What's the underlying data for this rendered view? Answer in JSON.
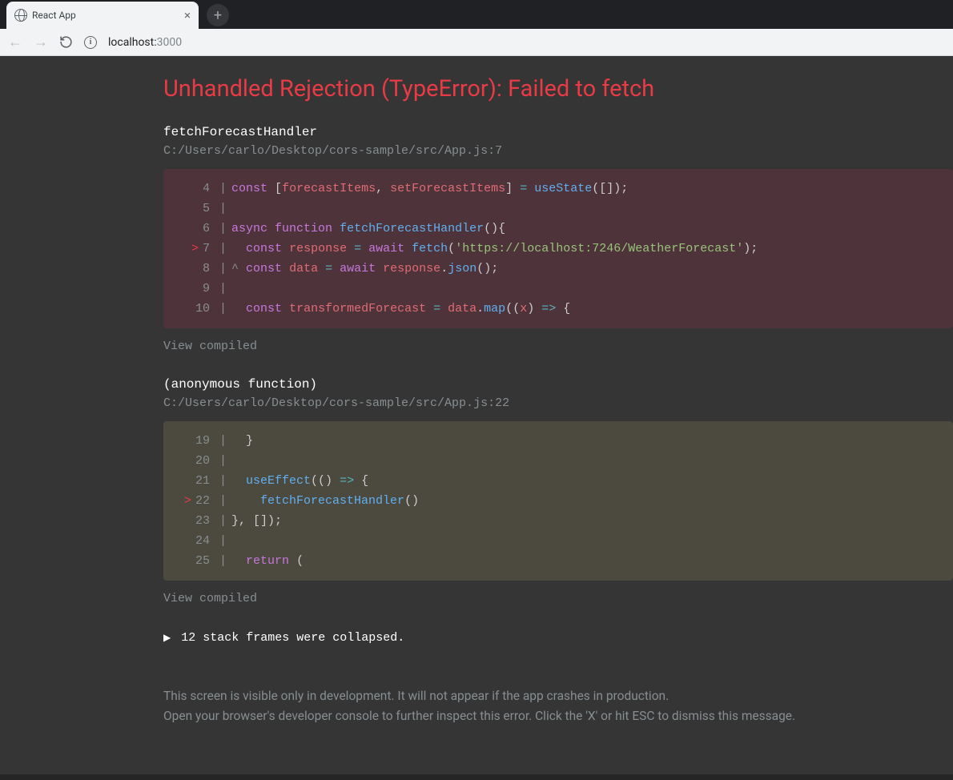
{
  "browser": {
    "tab_title": "React App",
    "url_host": "localhost:",
    "url_port": "3000"
  },
  "error": {
    "title": "Unhandled Rejection (TypeError): Failed to fetch",
    "frames": [
      {
        "func": "fetchForecastHandler",
        "path": "C:/Users/carlo/Desktop/cors-sample/src/App.js:7",
        "view_compiled": "View compiled",
        "block_class": "cb-a",
        "lines": [
          {
            "num": "4",
            "ptr": false,
            "html": "<span class='tok-kw'>const</span> <span class='tok-punc'>[</span><span class='tok-var'>forecastItems</span><span class='tok-punc'>,</span> <span class='tok-var'>setForecastItems</span><span class='tok-punc'>]</span> <span class='tok-op'>=</span> <span class='tok-fn'>useState</span><span class='tok-punc'>([]);</span>"
          },
          {
            "num": "5",
            "ptr": false,
            "html": ""
          },
          {
            "num": "6",
            "ptr": false,
            "html": "<span class='tok-kw'>async</span> <span class='tok-kw'>function</span> <span class='tok-fn'>fetchForecastHandler</span><span class='tok-punc'>(){</span>"
          },
          {
            "num": "7",
            "ptr": true,
            "html": "  <span class='tok-kw'>const</span> <span class='tok-var'>response</span> <span class='tok-op'>=</span> <span class='tok-kw'>await</span> <span class='tok-fn'>fetch</span><span class='tok-punc'>(</span><span class='tok-str'>'https://localhost:7246/WeatherForecast'</span><span class='tok-punc'>);</span>"
          },
          {
            "num": "8",
            "ptr": false,
            "html": "<span class='tok-caret'>^</span> <span class='tok-kw'>const</span> <span class='tok-var'>data</span> <span class='tok-op'>=</span> <span class='tok-kw'>await</span> <span class='tok-var'>response</span><span class='tok-punc'>.</span><span class='tok-fn'>json</span><span class='tok-punc'>();</span>"
          },
          {
            "num": "9",
            "ptr": false,
            "html": ""
          },
          {
            "num": "10",
            "ptr": false,
            "html": "  <span class='tok-kw'>const</span> <span class='tok-var'>transformedForecast</span> <span class='tok-op'>=</span> <span class='tok-var'>data</span><span class='tok-punc'>.</span><span class='tok-fn'>map</span><span class='tok-punc'>((</span><span class='tok-var'>x</span><span class='tok-punc'>)</span> <span class='tok-op'>=&gt;</span> <span class='tok-punc'>{</span>"
          }
        ]
      },
      {
        "func": "(anonymous function)",
        "path": "C:/Users/carlo/Desktop/cors-sample/src/App.js:22",
        "view_compiled": "View compiled",
        "block_class": "cb-b",
        "lines": [
          {
            "num": "19",
            "ptr": false,
            "html": "  <span class='tok-punc'>}</span>"
          },
          {
            "num": "20",
            "ptr": false,
            "html": ""
          },
          {
            "num": "21",
            "ptr": false,
            "html": "  <span class='tok-fn'>useEffect</span><span class='tok-punc'>(()</span> <span class='tok-op'>=&gt;</span> <span class='tok-punc'>{</span>"
          },
          {
            "num": "22",
            "ptr": true,
            "html": "    <span class='tok-fn'>fetchForecastHandler</span><span class='tok-punc'>()</span>"
          },
          {
            "num": "23",
            "ptr": false,
            "html": "<span class='tok-punc'>},</span> <span class='tok-punc'>[]);</span>"
          },
          {
            "num": "24",
            "ptr": false,
            "html": ""
          },
          {
            "num": "25",
            "ptr": false,
            "html": "  <span class='tok-kw'>return</span> <span class='tok-punc'>(</span>"
          }
        ]
      }
    ],
    "collapsed_text": "12 stack frames were collapsed.",
    "footer_line1": "This screen is visible only in development. It will not appear if the app crashes in production.",
    "footer_line2": "Open your browser's developer console to further inspect this error.  Click the 'X' or hit ESC to dismiss this message."
  }
}
